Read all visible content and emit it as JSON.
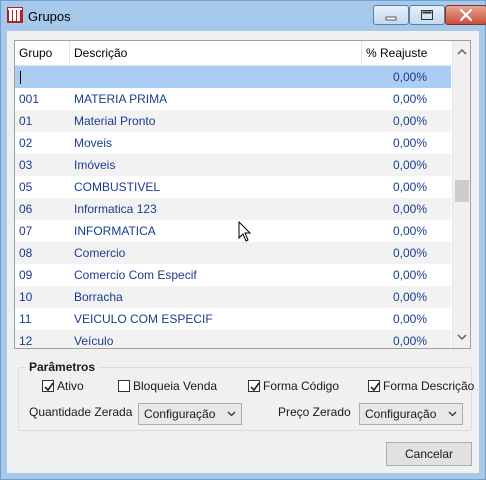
{
  "window": {
    "title": "Grupos",
    "controls": [
      "minimize-icon",
      "maximize-icon",
      "close-icon"
    ]
  },
  "grid": {
    "columns": [
      "Grupo",
      "Descrição",
      "% Reajuste"
    ],
    "rows": [
      {
        "code": "",
        "desc": "",
        "pct": "0,00%"
      },
      {
        "code": "001",
        "desc": "MATERIA PRIMA",
        "pct": "0,00%"
      },
      {
        "code": "01",
        "desc": "Material Pronto",
        "pct": "0,00%"
      },
      {
        "code": "02",
        "desc": "Moveis",
        "pct": "0,00%"
      },
      {
        "code": "03",
        "desc": "Imóveis",
        "pct": "0,00%"
      },
      {
        "code": "05",
        "desc": "COMBUSTIVEL",
        "pct": "0,00%"
      },
      {
        "code": "06",
        "desc": "Informatica 123",
        "pct": "0,00%"
      },
      {
        "code": "07",
        "desc": "INFORMATICA",
        "pct": "0,00%"
      },
      {
        "code": "08",
        "desc": "Comercio",
        "pct": "0,00%"
      },
      {
        "code": "09",
        "desc": "Comercio Com Especif",
        "pct": "0,00%"
      },
      {
        "code": "10",
        "desc": "Borracha",
        "pct": "0,00%"
      },
      {
        "code": "11",
        "desc": "VEICULO COM ESPECIF",
        "pct": "0,00%"
      },
      {
        "code": "12",
        "desc": "Veículo",
        "pct": "0,00%"
      }
    ]
  },
  "params": {
    "legend": "Parâmetros",
    "ativo": "Ativo",
    "bloqueia_venda": "Bloqueia Venda",
    "forma_codigo": "Forma Código",
    "forma_descricao": "Forma Descrição",
    "quantidade_zerada_label": "Quantidade Zerada",
    "quantidade_zerada_value": "Configuração",
    "preco_zerado_label": "Preço Zerado",
    "preco_zerado_value": "Configuração"
  },
  "buttons": {
    "cancel": "Cancelar"
  },
  "colors": {
    "titlebar": "#a6c8eb",
    "selected_row": "#a9cdf3",
    "row_text": "#1a3c8e"
  }
}
